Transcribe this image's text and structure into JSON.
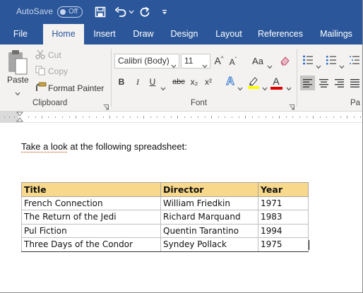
{
  "qat": {
    "autosave_label": "AutoSave",
    "autosave_state": "Off",
    "icons": [
      "save-icon",
      "undo-icon",
      "redo-icon",
      "customize-icon"
    ]
  },
  "tabs": [
    "File",
    "Home",
    "Insert",
    "Draw",
    "Design",
    "Layout",
    "References",
    "Mailings"
  ],
  "active_tab": "Home",
  "clipboard": {
    "paste": "Paste",
    "cut": "Cut",
    "copy": "Copy",
    "format_painter": "Format Painter",
    "group_label": "Clipboard"
  },
  "font": {
    "family": "Calibri (Body)",
    "size": "11",
    "change_case": "Aa",
    "bold": "B",
    "italic": "I",
    "underline": "U",
    "strikethrough": "abc",
    "subscript": "x₂",
    "superscript": "x²",
    "text_effects": "A",
    "font_color": "A",
    "grow": "A",
    "shrink": "A",
    "group_label": "Font"
  },
  "paragraph": {
    "group_label": "Pa"
  },
  "colors": {
    "brand": "#2b579a",
    "highlight": "#ffff00",
    "font_color_bar": "#e00000",
    "header_fill": "#f8d98c"
  },
  "document": {
    "intro_underlined": "Take a look",
    "intro_rest": " at the following spreadsheet:",
    "table": {
      "headers": [
        "Title",
        "Director",
        "Year"
      ],
      "rows": [
        [
          "French Connection",
          "William Friedkin",
          "1971"
        ],
        [
          "The Return of the Jedi",
          "Richard Marquand",
          "1983"
        ],
        [
          "Pul Fiction",
          "Quentin Tarantino",
          "1994"
        ],
        [
          "Three Days of the Condor",
          "Syndey Pollack",
          "1975"
        ]
      ]
    }
  }
}
